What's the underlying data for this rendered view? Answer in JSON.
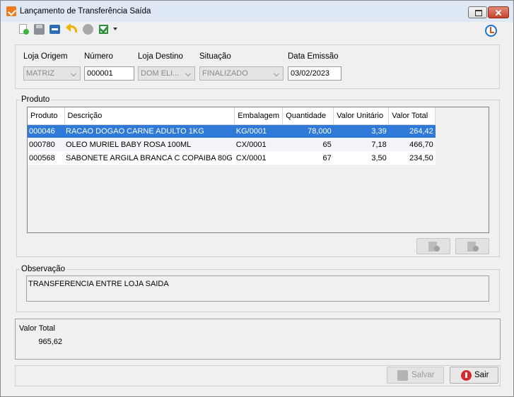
{
  "window": {
    "title": "Lançamento de Transferência Saída"
  },
  "toolbar": {
    "icons": [
      "new-document-icon",
      "save-icon",
      "transfer-icon",
      "undo-icon",
      "circle-icon",
      "check-icon",
      "dropdown-caret-icon",
      "timer-icon"
    ]
  },
  "header": {
    "loja_origem_label": "Loja Origem",
    "loja_origem_value": "MATRIZ",
    "numero_label": "Número",
    "numero_value": "000001",
    "loja_destino_label": "Loja Destino",
    "loja_destino_value": "DOM ELI...",
    "situacao_label": "Situação",
    "situacao_value": "FINALIZADO",
    "data_emissao_label": "Data Emissão",
    "data_emissao_value": "03/02/2023"
  },
  "produto": {
    "group_title": "Produto",
    "columns": {
      "produto": "Produto",
      "descricao": "Descrição",
      "embalagem": "Embalagem",
      "quantidade": "Quantidade",
      "valor_unitario": "Valor Unitário",
      "valor_total": "Valor Total"
    },
    "rows": [
      {
        "produto": "000046",
        "descricao": "RACAO DOGAO CARNE ADULTO 1KG",
        "embalagem": "KG/0001",
        "quantidade": "78,000",
        "valor_unitario": "3,39",
        "valor_total": "264,42"
      },
      {
        "produto": "000780",
        "descricao": "OLEO MURIEL BABY ROSA 100ML",
        "embalagem": "CX/0001",
        "quantidade": "65",
        "valor_unitario": "7,18",
        "valor_total": "466,70"
      },
      {
        "produto": "000568",
        "descricao": "SABONETE ARGILA BRANCA C COPAIBA 80G",
        "embalagem": "CX/0001",
        "quantidade": "67",
        "valor_unitario": "3,50",
        "valor_total": "234,50"
      }
    ],
    "selected_row": 0
  },
  "observacao": {
    "group_title": "Observação",
    "text": "TRANSFERENCIA ENTRE LOJA SAIDA"
  },
  "totals": {
    "valor_total_label": "Valor Total",
    "valor_total_value": "965,62"
  },
  "footer": {
    "salvar_label": "Salvar",
    "sair_label": "Sair"
  },
  "colors": {
    "selection": "#2f7ad6",
    "titlebar": "#dfe8f5",
    "close_button": "#c7432a",
    "window_bg": "#f0f0f0"
  }
}
